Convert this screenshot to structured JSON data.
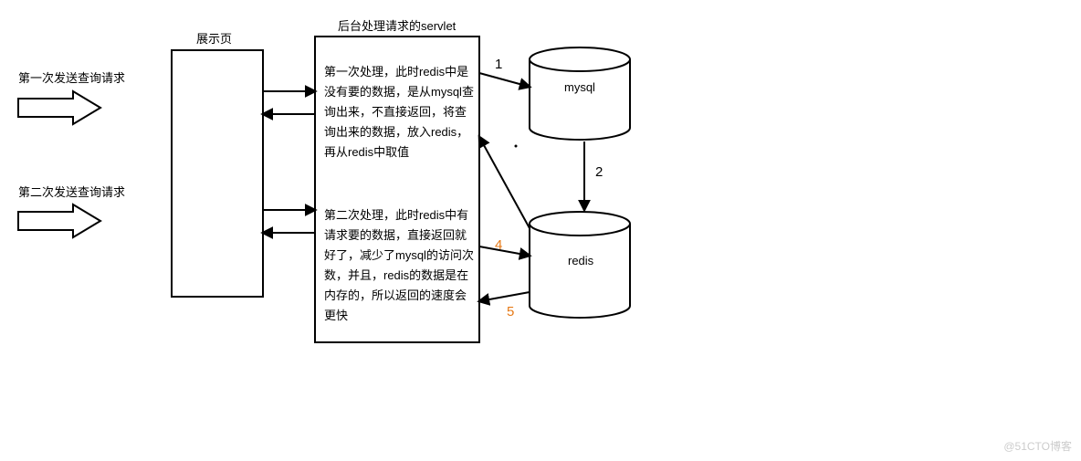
{
  "labels": {
    "display_page": "展示页",
    "servlet": "后台处理请求的servlet",
    "req1": "第一次发送查询请求",
    "req2": "第二次发送查询请求",
    "mysql": "mysql",
    "redis": "redis"
  },
  "desc": {
    "first": "第一次处理，此时redis中是没有要的数据，是从mysql查询出来，不直接返回，将查询出来的数据，放入redis，再从redis中取值",
    "second": "第二次处理，此时redis中有请求要的数据，直接返回就好了，减少了mysql的访问次数，并且，redis的数据是在内存的，所以返回的速度会更快"
  },
  "edge_nums": {
    "n1": "1",
    "n2": "2",
    "n4": "4",
    "n5": "5"
  },
  "watermark": "@51CTO博客"
}
